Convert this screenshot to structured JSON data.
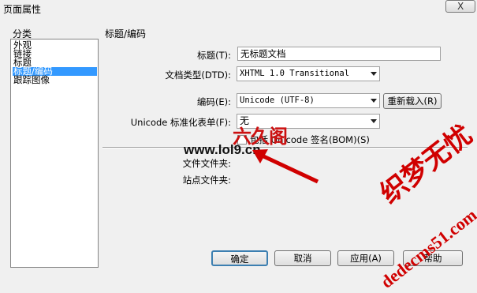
{
  "window": {
    "title": "页面属性",
    "close_label": "X"
  },
  "category": {
    "label": "分类",
    "items": [
      "外观",
      "链接",
      "标题",
      "标题/编码",
      "跟踪图像"
    ],
    "selected_index": 3
  },
  "section": {
    "title": "标题/编码"
  },
  "fields": {
    "title_label": "标题(T):",
    "title_value": "无标题文档",
    "doctype_label": "文档类型(DTD):",
    "doctype_value": "XHTML 1.0 Transitional",
    "encoding_label": "编码(E):",
    "encoding_value": "Unicode (UTF-8)",
    "reload_button": "重新载入(R)",
    "normalization_label": "Unicode 标准化表单(F):",
    "normalization_value": "无",
    "bom_checkbox_label": "包括 Unicode 签名(BOM)(S)",
    "bom_checked": false,
    "doc_folder_label": "文件文件夹:",
    "site_folder_label": "站点文件夹:"
  },
  "buttons": {
    "ok": "确定",
    "cancel": "取消",
    "apply": "应用(A)",
    "help": "帮助"
  },
  "watermarks": {
    "logo_text": "六久阁",
    "url_text": "www.lol9.cn",
    "brand_text": "织梦无忧",
    "site_text": "dedecms51.com",
    "accent_color": "#d00000"
  }
}
